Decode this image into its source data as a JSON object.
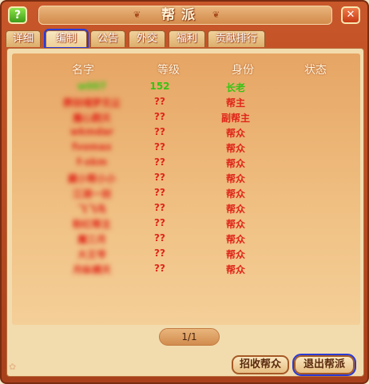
{
  "window": {
    "title": "帮派"
  },
  "tabs": [
    "详细",
    "编制",
    "公告",
    "外交",
    "福利",
    "贡献排行"
  ],
  "active_tab": "编制",
  "columns": {
    "name": "名字",
    "level": "等级",
    "role": "身份",
    "status": "状态"
  },
  "members": [
    {
      "name": "w007",
      "level": "152",
      "role": "长老",
      "color": "#35c414"
    },
    {
      "name": "葬剑魂梦无尘",
      "level": "??",
      "role": "帮主",
      "color": "#e0261a"
    },
    {
      "name": "魔心戮天",
      "level": "??",
      "role": "副帮主",
      "color": "#e0261a"
    },
    {
      "name": "wkmdar",
      "level": "??",
      "role": "帮众",
      "color": "#e0261a"
    },
    {
      "name": "fvomax",
      "level": "??",
      "role": "帮众",
      "color": "#e0261a"
    },
    {
      "name": "f-xkm",
      "level": "??",
      "role": "帮众",
      "color": "#e0261a"
    },
    {
      "name": "藏小帮小小",
      "level": "??",
      "role": "帮众",
      "color": "#e0261a"
    },
    {
      "name": "江湖一剑",
      "level": "??",
      "role": "帮众",
      "color": "#e0261a"
    },
    {
      "name": "飞飞鸟",
      "level": "??",
      "role": "帮众",
      "color": "#e0261a"
    },
    {
      "name": "粉红帮主",
      "level": "??",
      "role": "帮众",
      "color": "#e0261a"
    },
    {
      "name": "魔三月",
      "level": "??",
      "role": "帮众",
      "color": "#e0261a"
    },
    {
      "name": "大王爷",
      "level": "??",
      "role": "帮众",
      "color": "#e0261a"
    },
    {
      "name": "月纵横天",
      "level": "??",
      "role": "帮众",
      "color": "#e0261a"
    }
  ],
  "pager": "1/1",
  "buttons": {
    "recruit": "招收帮众",
    "leave": "退出帮派"
  },
  "icons": {
    "help": "question-icon",
    "close": "close-icon"
  },
  "help_glyph": "?",
  "close_glyph": "✕"
}
